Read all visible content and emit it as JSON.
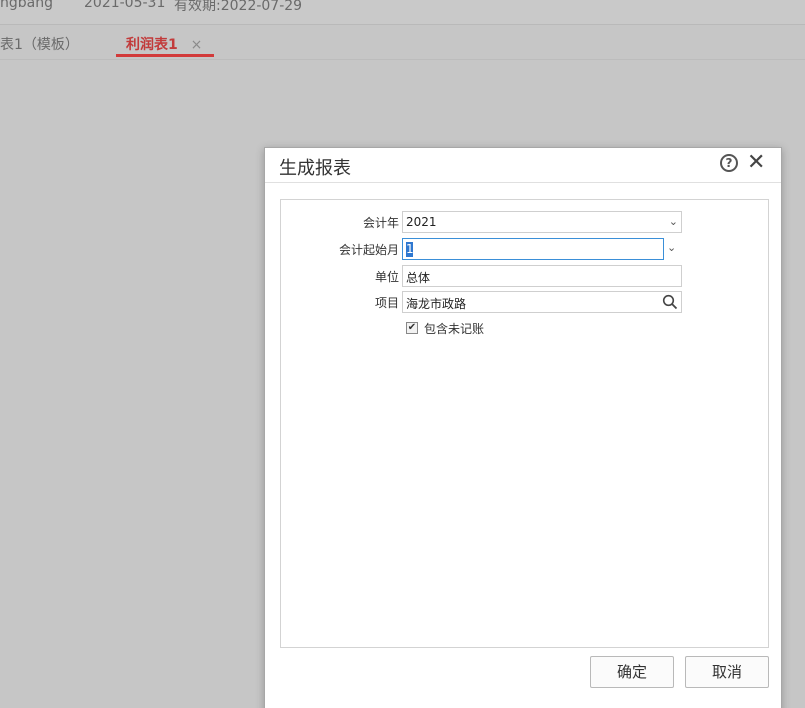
{
  "topbar": {
    "user": "ngbang",
    "date": "2021-05-31",
    "valid": "有效期:2022-07-29"
  },
  "tabs": [
    {
      "label": "表1（模板）"
    },
    {
      "label": "利润表1",
      "close": "×"
    }
  ],
  "dialog": {
    "title": "生成报表",
    "fields": {
      "fiscal_year": {
        "label": "会计年",
        "value": "2021"
      },
      "start_month": {
        "label": "会计起始月",
        "value": "1"
      },
      "unit": {
        "label": "单位",
        "value": "总体"
      },
      "project": {
        "label": "项目",
        "value": "海龙市政路"
      }
    },
    "checkbox": {
      "label": "包含未记账",
      "checked": true
    },
    "buttons": {
      "ok": "确定",
      "cancel": "取消"
    }
  },
  "icons": {
    "help": "question-circle-icon",
    "close": "close-icon",
    "search": "search-icon",
    "dropdown": "chevron-down-icon"
  }
}
